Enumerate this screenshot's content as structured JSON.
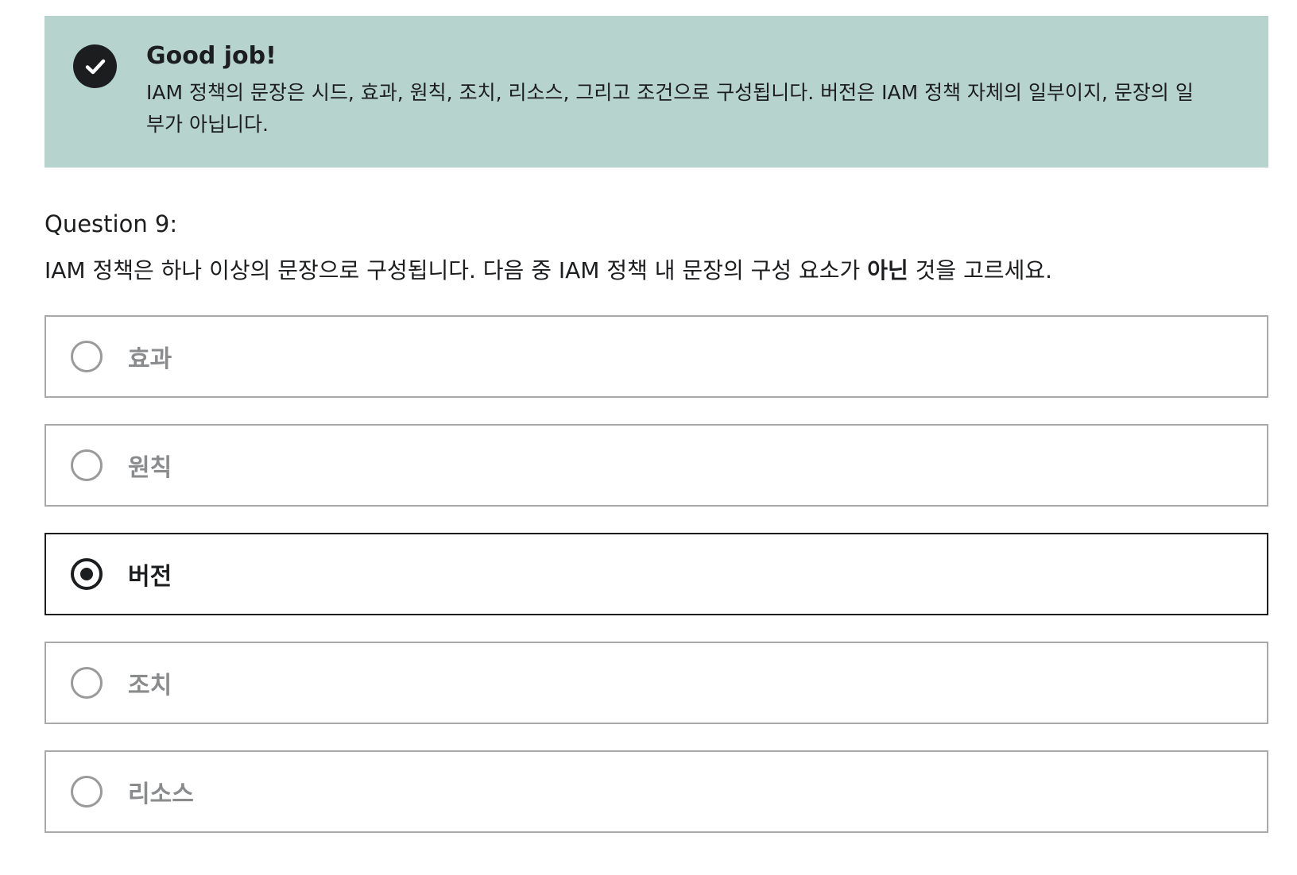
{
  "feedback": {
    "icon": "check-circle-icon",
    "title": "Good job!",
    "text": "IAM 정책의 문장은 시드, 효과, 원칙, 조치, 리소스, 그리고 조건으로 구성됩니다. 버전은 IAM 정책 자체의 일부이지, 문장의 일부가 아닙니다.",
    "background": "#b6d3cd"
  },
  "question": {
    "label": "Question 9:",
    "text_before": "IAM 정책은 하나 이상의 문장으로 구성됩니다. 다음 중 IAM 정책 내 문장의 구성 요소가 ",
    "text_bold": "아닌",
    "text_after": " 것을 고르세요."
  },
  "options": [
    {
      "label": "효과",
      "selected": false
    },
    {
      "label": "원칙",
      "selected": false
    },
    {
      "label": "버전",
      "selected": true
    },
    {
      "label": "조치",
      "selected": false
    },
    {
      "label": "리소스",
      "selected": false
    }
  ]
}
